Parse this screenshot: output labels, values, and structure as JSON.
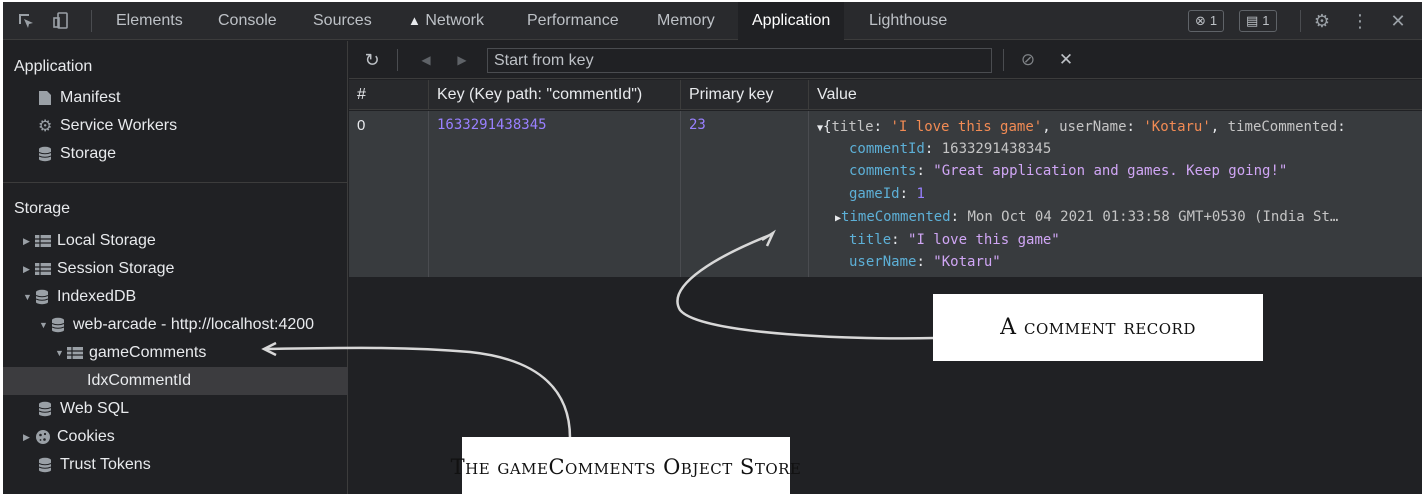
{
  "toolbar": {
    "tabs": [
      "Elements",
      "Console",
      "Sources",
      "Network",
      "Performance",
      "Memory",
      "Application",
      "Lighthouse"
    ],
    "active_tab": "Application",
    "errors_count": "1",
    "messages_count": "1"
  },
  "sidebar": {
    "application_header": "Application",
    "application_items": [
      "Manifest",
      "Service Workers",
      "Storage"
    ],
    "storage_header": "Storage",
    "storage_items": {
      "local_storage": "Local Storage",
      "session_storage": "Session Storage",
      "indexeddb": "IndexedDB",
      "database": "web-arcade - http://localhost:4200",
      "object_store": "gameComments",
      "index": "IdxCommentId",
      "web_sql": "Web SQL",
      "cookies": "Cookies",
      "trust_tokens": "Trust Tokens"
    }
  },
  "main": {
    "start_key_placeholder": "Start from key",
    "columns": [
      "#",
      "Key (Key path: \"commentId\")",
      "Primary key",
      "Value"
    ],
    "row": {
      "index": "0",
      "key": "1633291438345",
      "primary_key": "23",
      "summary_open": "{",
      "summary_title_key": "title",
      "summary_title_val": "'I love this game'",
      "summary_user_key": "userName",
      "summary_user_val": "'Kotaru'",
      "summary_time_key": "timeCommented",
      "fields": {
        "commentId_key": "commentId",
        "commentId_val": "1633291438345",
        "comments_key": "comments",
        "comments_val": "\"Great application and games. Keep going!\"",
        "gameId_key": "gameId",
        "gameId_val": "1",
        "timeCommented_key": "timeCommented",
        "timeCommented_val": "Mon Oct 04 2021 01:33:58 GMT+0530 (India St…",
        "title_key": "title",
        "title_val": "\"I love this game\"",
        "userName_key": "userName",
        "userName_val": "\"Kotaru\""
      }
    }
  },
  "annotations": {
    "comment_record": "A comment record",
    "object_store": "The gameComments Object Store"
  }
}
